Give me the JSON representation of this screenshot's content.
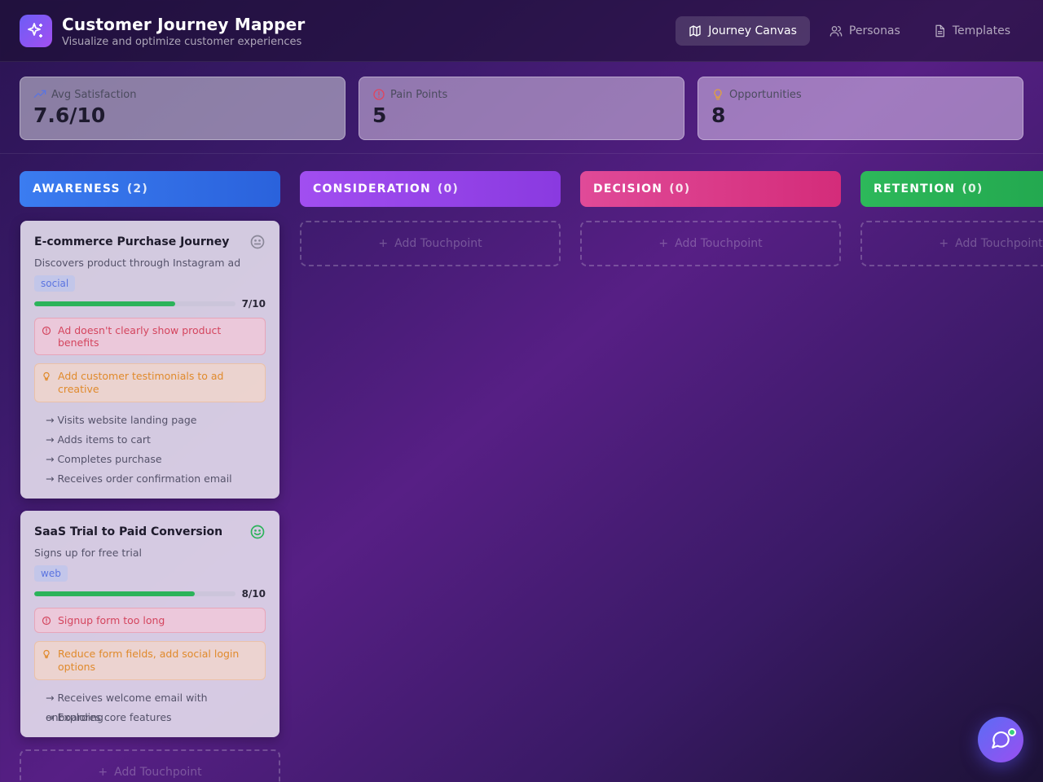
{
  "app": {
    "title": "Customer Journey Mapper",
    "subtitle": "Visualize and optimize customer experiences"
  },
  "nav": [
    {
      "label": "Journey Canvas",
      "icon": "map-icon",
      "active": true
    },
    {
      "label": "Personas",
      "icon": "users-icon",
      "active": false
    },
    {
      "label": "Templates",
      "icon": "document-icon",
      "active": false
    }
  ],
  "stats": [
    {
      "label": "Avg Satisfaction",
      "value": "7.6/10",
      "icon": "trending-up-icon"
    },
    {
      "label": "Pain Points",
      "value": "5",
      "icon": "alert-circle-icon"
    },
    {
      "label": "Opportunities",
      "value": "8",
      "icon": "lightbulb-icon"
    }
  ],
  "columns": [
    {
      "name": "AWARENESS",
      "count": "(2)",
      "color_from": "#3b7cf0",
      "color_to": "#2a62dc"
    },
    {
      "name": "CONSIDERATION",
      "count": "(0)",
      "color_from": "#a14ef0",
      "color_to": "#8a3ae0"
    },
    {
      "name": "DECISION",
      "count": "(0)",
      "color_from": "#e04a98",
      "color_to": "#d42c7a"
    },
    {
      "name": "RETENTION",
      "count": "(0)",
      "color_from": "#2db85a",
      "color_to": "#1fa24b"
    }
  ],
  "add_touchpoint_label": "Add Touchpoint",
  "cards": [
    {
      "title": "E-commerce Purchase Journey",
      "description": "Discovers product through Instagram ad",
      "tag": "social",
      "score": 7,
      "score_label": "7/10",
      "sentiment": "neutral",
      "pain_point": "Ad doesn't clearly show product benefits",
      "opportunity": "Add customer testimonials to ad creative",
      "steps": [
        "→ Visits website landing page",
        "→ Adds items to cart",
        "→ Completes purchase",
        "→ Receives order confirmation email"
      ]
    },
    {
      "title": "SaaS Trial to Paid Conversion",
      "description": "Signs up for free trial",
      "tag": "web",
      "score": 8,
      "score_label": "8/10",
      "sentiment": "positive",
      "pain_point": "Signup form too long",
      "opportunity": "Reduce form fields, add social login options",
      "steps": [
        "→ Receives welcome email with onboarding",
        "→ Explores core features"
      ]
    }
  ],
  "colors": {
    "accent": "#7b5cf5",
    "positive": "#2bb35a",
    "pain": "#d4455e",
    "opportunity": "#e08a2c"
  }
}
